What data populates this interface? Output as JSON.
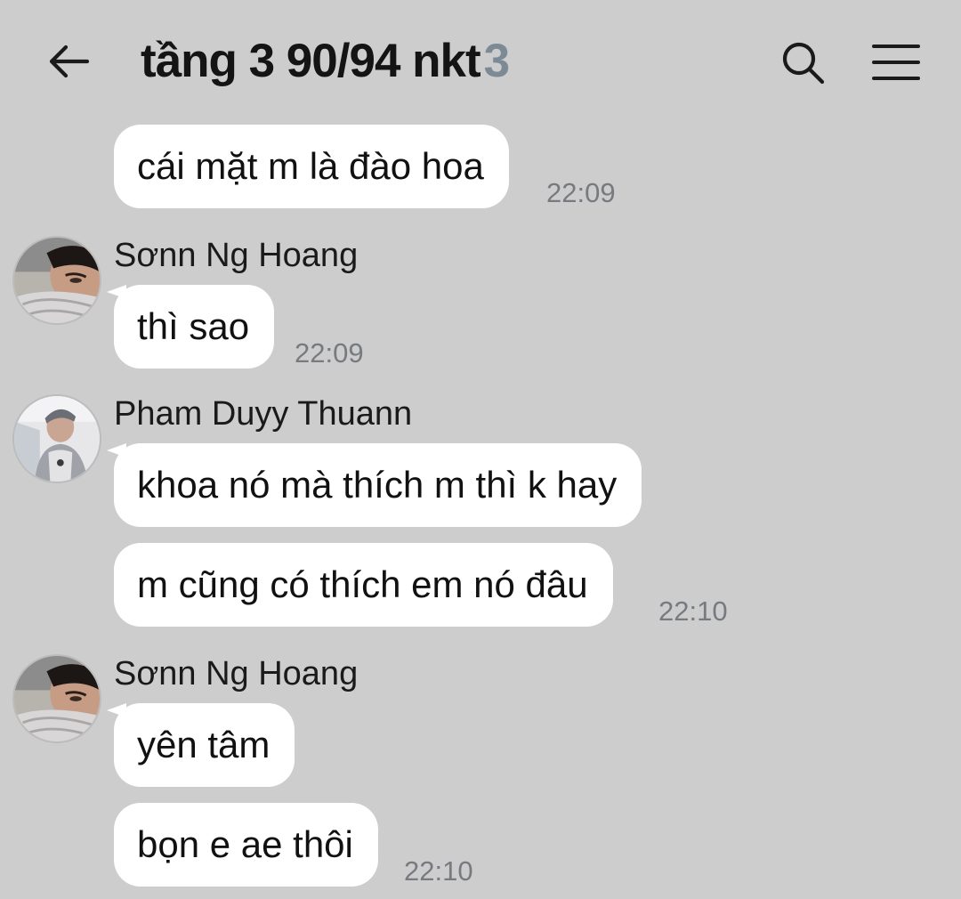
{
  "header": {
    "title": "tầng 3 90/94 nkt",
    "member_count": "3",
    "back_icon": "arrow-left-icon",
    "search_icon": "search-icon",
    "menu_icon": "menu-icon"
  },
  "colors": {
    "background": "#cdcdcd",
    "bubble": "#ffffff",
    "member_count": "#7c8a96",
    "timestamp": "#777b80"
  },
  "messages": [
    {
      "text": "cái mặt m là đào hoa",
      "time": "22:09"
    },
    {
      "sender": "Sơnn Ng Hoang",
      "text": "thì sao",
      "time": "22:09"
    },
    {
      "sender": "Pham Duyy Thuann",
      "text": "khoa nó mà thích m thì k hay"
    },
    {
      "text": "m cũng có thích em nó đâu",
      "time": "22:10"
    },
    {
      "sender": "Sơnn Ng Hoang",
      "text": "yên tâm"
    },
    {
      "text": "bọn e ae thôi",
      "time": "22:10"
    }
  ]
}
